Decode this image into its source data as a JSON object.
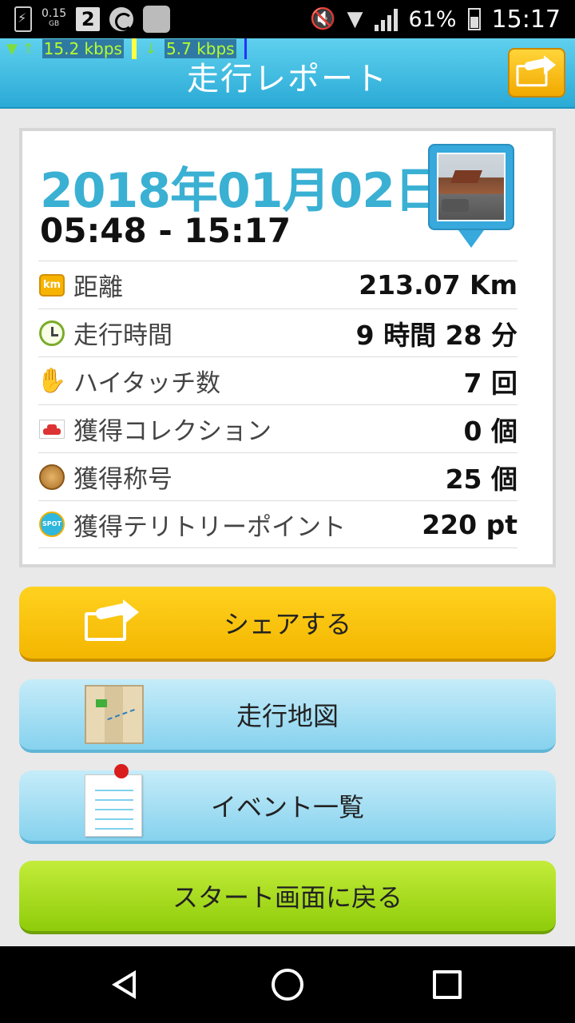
{
  "status_bar": {
    "data_usage": "0.15",
    "data_unit": "GB",
    "notif_count": "2",
    "battery_pct": "61%",
    "time": "15:17"
  },
  "netspeed": {
    "up": "15.2 kbps",
    "down": "5.7 kbps"
  },
  "header": {
    "title": "走行レポート"
  },
  "report": {
    "date": "2018年01月02日",
    "time_range": "05:48 - 15:17",
    "stats": [
      {
        "icon": "km-icon",
        "label": "距離",
        "value": "213.07 Km"
      },
      {
        "icon": "clock-icon",
        "label": "走行時間",
        "value": "9 時間 28 分"
      },
      {
        "icon": "hand-icon",
        "label": "ハイタッチ数",
        "value": "7 回"
      },
      {
        "icon": "car-icon",
        "label": "獲得コレクション",
        "value": "0 個"
      },
      {
        "icon": "medal-icon",
        "label": "獲得称号",
        "value": "25 個"
      },
      {
        "icon": "spot-icon",
        "label": "獲得テリトリーポイント",
        "value": "220 pt"
      }
    ]
  },
  "icon_text": {
    "km": "km",
    "spot": "SPOT"
  },
  "buttons": {
    "share": "シェアする",
    "map": "走行地図",
    "events": "イベント一覧",
    "back_to_start": "スタート画面に戻る"
  },
  "colors": {
    "header": "#2aaad6",
    "date": "#3ab0d3",
    "share_button": "#f3b600",
    "map_button": "#86d2ee",
    "start_button": "#8fcc0a"
  }
}
